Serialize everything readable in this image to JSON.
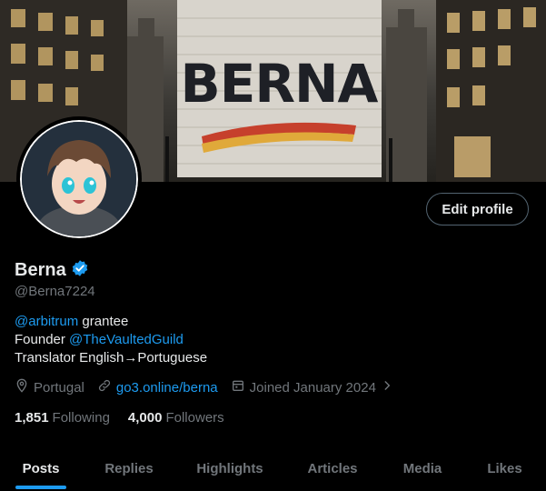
{
  "banner": {
    "text": "BERNA"
  },
  "profile": {
    "name": "Berna",
    "handle": "@Berna7224",
    "edit_label": "Edit profile"
  },
  "bio": {
    "line1_link": "@arbitrum",
    "line1_text": " grantee",
    "line2_text": "Founder ",
    "line2_link": "@TheVaultedGuild",
    "line3_text": "Translator English→Portuguese"
  },
  "meta": {
    "location": "Portugal",
    "website": "go3.online/berna",
    "joined": "Joined January 2024"
  },
  "stats": {
    "following_count": "1,851",
    "following_label": "Following",
    "followers_count": "4,000",
    "followers_label": "Followers"
  },
  "tabs": [
    {
      "label": "Posts"
    },
    {
      "label": "Replies"
    },
    {
      "label": "Highlights"
    },
    {
      "label": "Articles"
    },
    {
      "label": "Media"
    },
    {
      "label": "Likes"
    }
  ],
  "colors": {
    "accent": "#1d9bf0",
    "muted": "#71767b",
    "text": "#e7e9ea",
    "verified": "#1d9bf0"
  }
}
